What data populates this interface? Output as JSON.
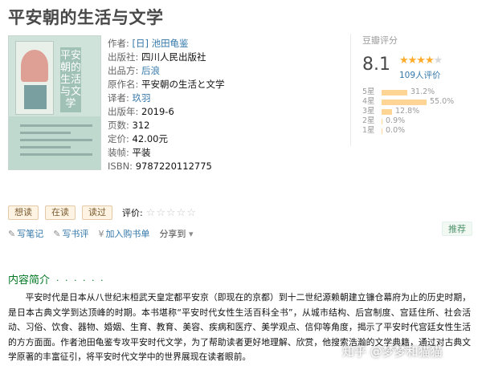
{
  "title": "平安朝的生活与文学",
  "info": {
    "author_label": "作者:",
    "author": "[日] 池田龟鉴",
    "publisher_label": "出版社:",
    "publisher": "四川人民出版社",
    "producer_label": "出品方:",
    "producer": "后浪",
    "original_label": "原作名:",
    "original": "平安朝の生活と文学",
    "translator_label": "译者:",
    "translator": "玖羽",
    "year_label": "出版年:",
    "year": "2019-6",
    "pages_label": "页数:",
    "pages": "312",
    "price_label": "定价:",
    "price": "42.00元",
    "binding_label": "装帧:",
    "binding": "平装",
    "isbn_label": "ISBN:",
    "isbn": "9787220112775"
  },
  "cover": {
    "vtitle": "平安朝的生活与文学"
  },
  "rating": {
    "header": "豆瓣评分",
    "score": "8.1",
    "stars_filled": 4,
    "count": "109人评价",
    "bars": [
      {
        "label": "5星",
        "percent": "31.2%",
        "value": 31.2
      },
      {
        "label": "4星",
        "percent": "55.0%",
        "value": 55.0
      },
      {
        "label": "3星",
        "percent": "12.8%",
        "value": 12.8
      },
      {
        "label": "2星",
        "percent": "0.9%",
        "value": 0.9
      },
      {
        "label": "1星",
        "percent": "0.0%",
        "value": 0.0
      }
    ]
  },
  "actions": {
    "want": "想读",
    "reading": "在读",
    "read": "读过",
    "rate_label": "评价:"
  },
  "tools": {
    "note": "写笔记",
    "review": "写书评",
    "cart": "加入购书单",
    "share": "分享到",
    "recommend": "推荐"
  },
  "intro": {
    "title": "内容简介",
    "dots": "· · · · · ·",
    "text": "平安时代是日本从八世纪末桓武天皇定都平安京（即现在的京都）到十二世纪源赖朝建立镰仓幕府为止的历史时期，是日本古典文学到达顶峰的时期。本书堪称“平安时代女性生活百科全书”，从城市结构、后宫制度、宫廷住所、社会活动、习俗、饮食、器物、婚姻、生育、教育、美容、疾病和医疗、美学观点、信仰等角度，揭示了平安时代宫廷女性生活的方方面面。作者池田龟鉴专攻平安时代文学，为了帮助读者更好地理解、欣赏，他搜索浩瀚的文学典籍，通过对古典文学原著的丰富征引，将平安时代文学中的世界展现在读者眼前。"
  },
  "watermark": "知乎 @梦梦和猫猫"
}
